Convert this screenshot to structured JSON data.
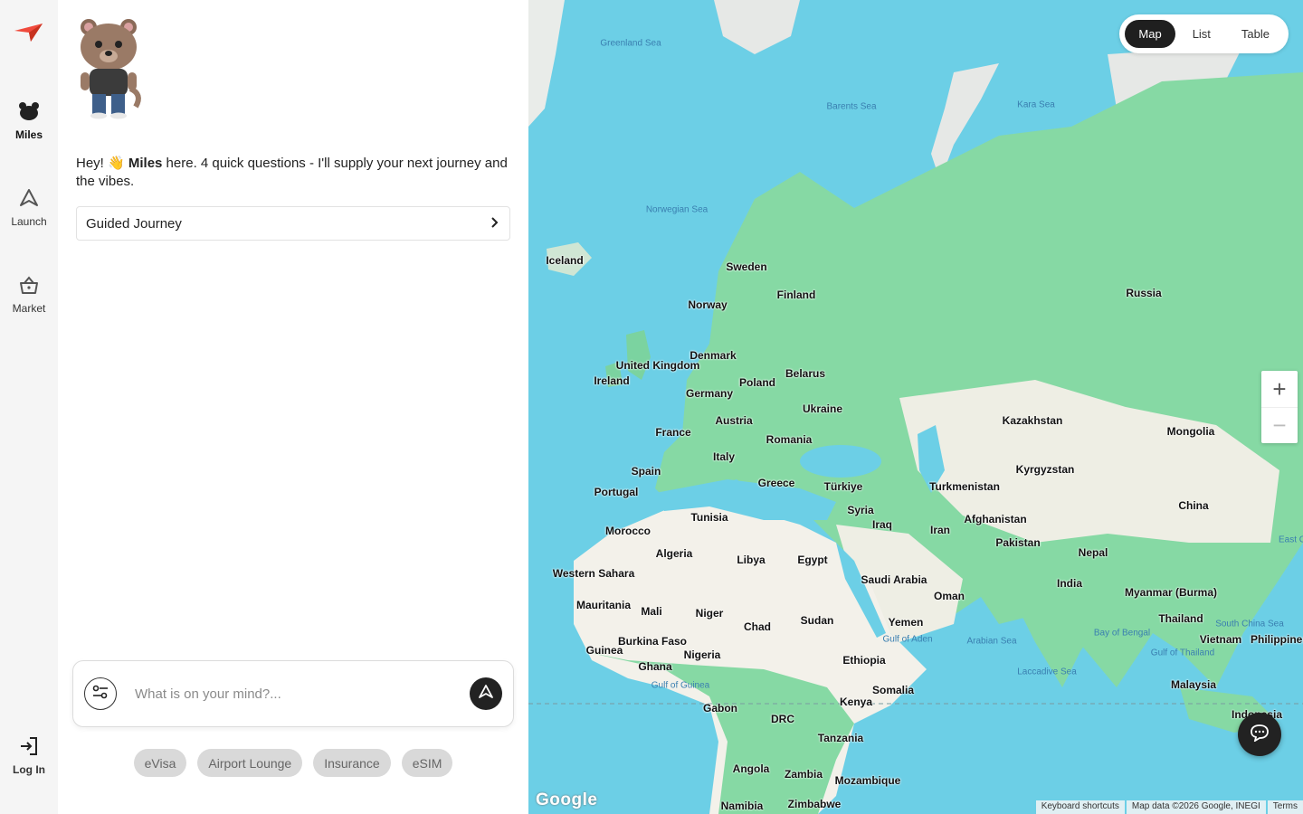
{
  "rail": {
    "logo_icon": "paper-plane-icon",
    "items": [
      {
        "label": "Miles",
        "icon": "bear-icon",
        "active": true
      },
      {
        "label": "Launch",
        "icon": "launch-icon",
        "active": false
      },
      {
        "label": "Market",
        "icon": "basket-icon",
        "active": false
      }
    ],
    "login_label": "Log In"
  },
  "chat": {
    "greeting_pre": "Hey! 👋 ",
    "greeting_name": "Miles",
    "greeting_post": " here. 4 quick questions - I'll supply your next journey and the vibes.",
    "guided_label": "Guided Journey",
    "input_placeholder": "What is on your mind?...",
    "chips": [
      "eVisa",
      "Airport Lounge",
      "Insurance",
      "eSIM"
    ]
  },
  "map": {
    "view_toggle": [
      "Map",
      "List",
      "Table"
    ],
    "active_view": "Map",
    "zoom_in": "+",
    "zoom_out": "−",
    "google_logo": "Google",
    "attribution": [
      "Keyboard shortcuts",
      "Map data ©2026 Google, INEGI",
      "Terms"
    ],
    "countries": [
      "Iceland",
      "Sweden",
      "Norway",
      "Finland",
      "Russia",
      "United Kingdom",
      "Ireland",
      "Denmark",
      "Belarus",
      "Poland",
      "Germany",
      "Ukraine",
      "Austria",
      "France",
      "Romania",
      "Kazakhstan",
      "Mongolia",
      "Spain",
      "Italy",
      "Portugal",
      "Greece",
      "Türkiye",
      "Kyrgyzstan",
      "Turkmenistan",
      "Syria",
      "Iraq",
      "Tunisia",
      "Afghanistan",
      "Morocco",
      "Iran",
      "China",
      "Algeria",
      "Libya",
      "Egypt",
      "Pakistan",
      "Nepal",
      "Western Sahara",
      "Saudi Arabia",
      "India",
      "Myanmar (Burma)",
      "Oman",
      "Mauritania",
      "Mali",
      "Niger",
      "Thailand",
      "Chad",
      "Sudan",
      "Yemen",
      "Vietnam",
      "Philippines",
      "Burkina Faso",
      "Guinea",
      "Nigeria",
      "Ghana",
      "Ethiopia",
      "Malaysia",
      "Somalia",
      "Kenya",
      "Gabon",
      "DRC",
      "Indonesia",
      "Tanzania",
      "Angola",
      "Zambia",
      "Mozambique",
      "Namibia",
      "Zimbabwe"
    ],
    "seas": [
      "Greenland Sea",
      "Barents Sea",
      "Kara Sea",
      "Norwegian Sea",
      "Gulf of Aden",
      "Arabian Sea",
      "Bay of Bengal",
      "South China Sea",
      "Gulf of Thailand",
      "Gulf of Guinea",
      "Laccadive Sea",
      "East C"
    ]
  }
}
